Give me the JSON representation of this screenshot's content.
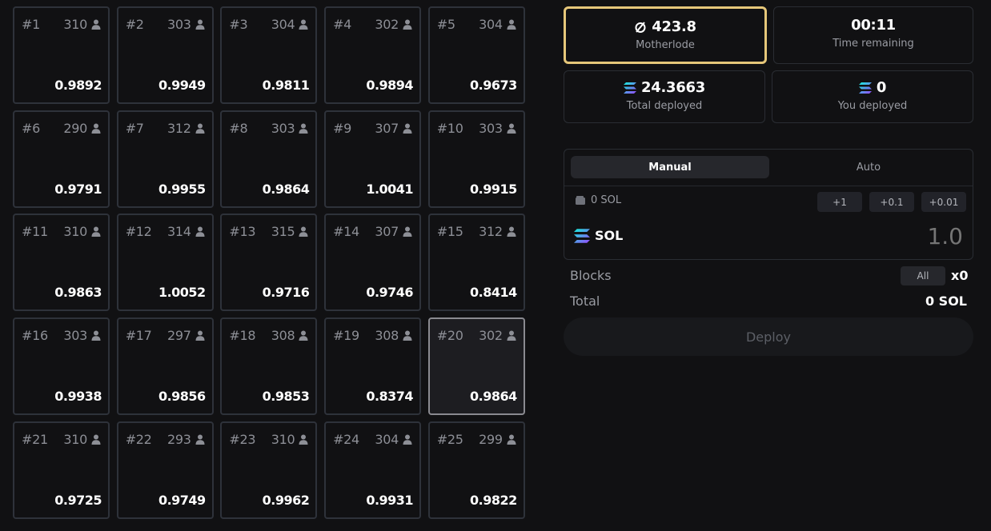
{
  "blocks": [
    {
      "num": "#1",
      "miners": "310",
      "value": "0.9892"
    },
    {
      "num": "#2",
      "miners": "303",
      "value": "0.9949"
    },
    {
      "num": "#3",
      "miners": "304",
      "value": "0.9811"
    },
    {
      "num": "#4",
      "miners": "302",
      "value": "0.9894"
    },
    {
      "num": "#5",
      "miners": "304",
      "value": "0.9673"
    },
    {
      "num": "#6",
      "miners": "290",
      "value": "0.9791"
    },
    {
      "num": "#7",
      "miners": "312",
      "value": "0.9955"
    },
    {
      "num": "#8",
      "miners": "303",
      "value": "0.9864"
    },
    {
      "num": "#9",
      "miners": "307",
      "value": "1.0041"
    },
    {
      "num": "#10",
      "miners": "303",
      "value": "0.9915"
    },
    {
      "num": "#11",
      "miners": "310",
      "value": "0.9863"
    },
    {
      "num": "#12",
      "miners": "314",
      "value": "1.0052"
    },
    {
      "num": "#13",
      "miners": "315",
      "value": "0.9716"
    },
    {
      "num": "#14",
      "miners": "307",
      "value": "0.9746"
    },
    {
      "num": "#15",
      "miners": "312",
      "value": "0.8414"
    },
    {
      "num": "#16",
      "miners": "303",
      "value": "0.9938"
    },
    {
      "num": "#17",
      "miners": "297",
      "value": "0.9856"
    },
    {
      "num": "#18",
      "miners": "308",
      "value": "0.9853"
    },
    {
      "num": "#19",
      "miners": "308",
      "value": "0.8374"
    },
    {
      "num": "#20",
      "miners": "302",
      "value": "0.9864",
      "selected": true
    },
    {
      "num": "#21",
      "miners": "310",
      "value": "0.9725"
    },
    {
      "num": "#22",
      "miners": "293",
      "value": "0.9749"
    },
    {
      "num": "#23",
      "miners": "310",
      "value": "0.9962"
    },
    {
      "num": "#24",
      "miners": "304",
      "value": "0.9931"
    },
    {
      "num": "#25",
      "miners": "299",
      "value": "0.9822"
    }
  ],
  "stats": {
    "motherlode": {
      "value": "423.8",
      "label": "Motherlode",
      "icon": "motherlode-icon"
    },
    "time": {
      "value": "00:11",
      "label": "Time remaining"
    },
    "total": {
      "value": "24.3663",
      "label": "Total deployed",
      "icon": "solana-icon"
    },
    "you": {
      "value": "0",
      "label": "You deployed",
      "icon": "solana-icon"
    }
  },
  "panel": {
    "tabs": [
      "Manual",
      "Auto"
    ],
    "balance": "0 SOL",
    "increments": [
      "+1",
      "+0.1",
      "+0.01"
    ],
    "token": "SOL",
    "amount_placeholder": "1.0"
  },
  "blocks_row": {
    "label": "Blocks",
    "button": "All",
    "value": "x0"
  },
  "total_row": {
    "label": "Total",
    "value": "0 SOL"
  },
  "deploy_label": "Deploy",
  "colors": {
    "accent_gold": "#e6c77a",
    "background": "#111113",
    "cell_border": "#2e323a"
  }
}
